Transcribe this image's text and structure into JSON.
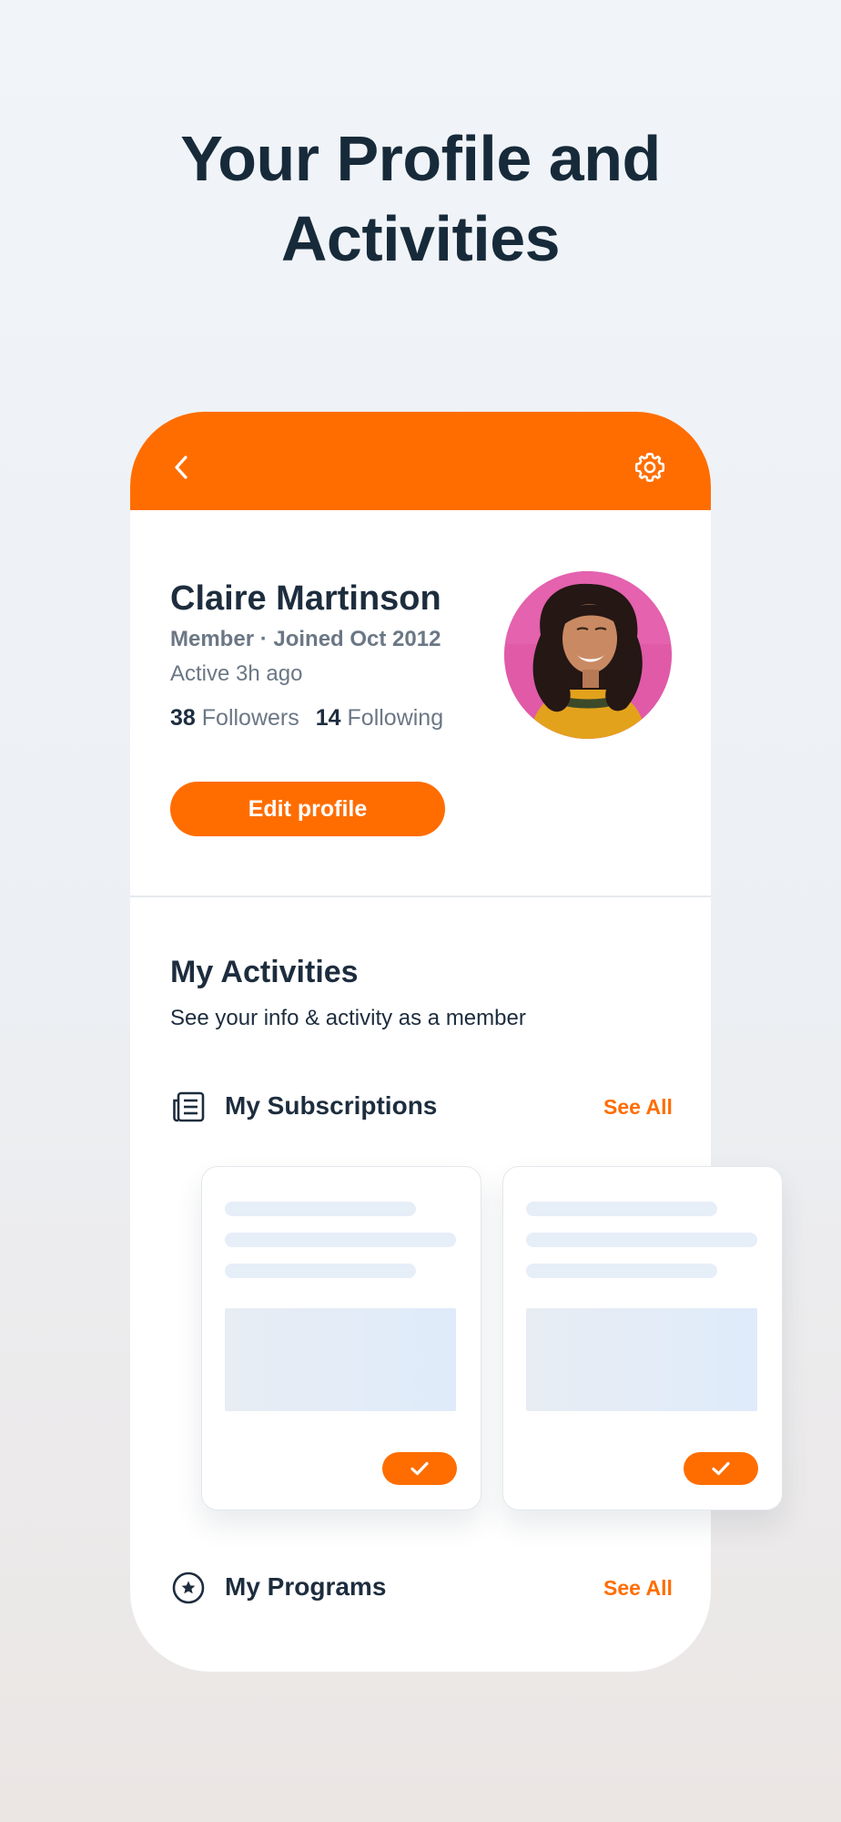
{
  "headline": {
    "line1": "Your Profile and",
    "line2": "Activities"
  },
  "profile": {
    "name": "Claire Martinson",
    "meta": "Member · Joined Oct 2012",
    "active": "Active 3h ago",
    "followers_count": "38",
    "followers_label": "Followers",
    "following_count": "14",
    "following_label": "Following",
    "edit_button": "Edit profile"
  },
  "activities": {
    "title": "My Activities",
    "subtitle": "See your info & activity as a member",
    "subscriptions_label": "My Subscriptions",
    "subscriptions_see_all": "See All",
    "programs_label": "My Programs",
    "programs_see_all": "See All"
  },
  "icons": {
    "back": "chevron-left-icon",
    "settings": "gear-icon",
    "subscriptions": "newspaper-icon",
    "programs": "star-circle-icon",
    "check": "checkmark-icon"
  },
  "colors": {
    "accent": "#ff6d00",
    "text_dark": "#1d2d3e",
    "text_muted": "#6b7785",
    "avatar_bg": "#e05aa8"
  }
}
